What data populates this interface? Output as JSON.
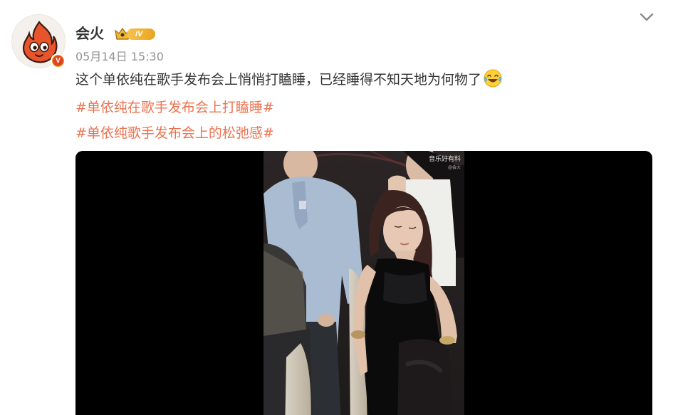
{
  "author": {
    "name": "会火",
    "level": "IV",
    "verified_mark": "V",
    "avatar_icon": "flame-mascot-icon"
  },
  "post": {
    "timestamp": "05月14日 15:30",
    "text": "这个单依纯在歌手发布会上悄悄打瞌睡，已经睡得不知天地为何物了",
    "emoji": "laughing-tears-emoji",
    "hashtags": [
      "#单依纯在歌手发布会上打瞌睡#",
      "#单依纯歌手发布会上的松弛感#"
    ]
  },
  "media": {
    "watermark": "音乐好有料",
    "watermark_sub": "@会火"
  },
  "colors": {
    "hashtag": "#eb7350",
    "timestamp": "#939393",
    "text": "#333333",
    "badge_gold": "#e9a420",
    "media_bg": "#000000"
  }
}
